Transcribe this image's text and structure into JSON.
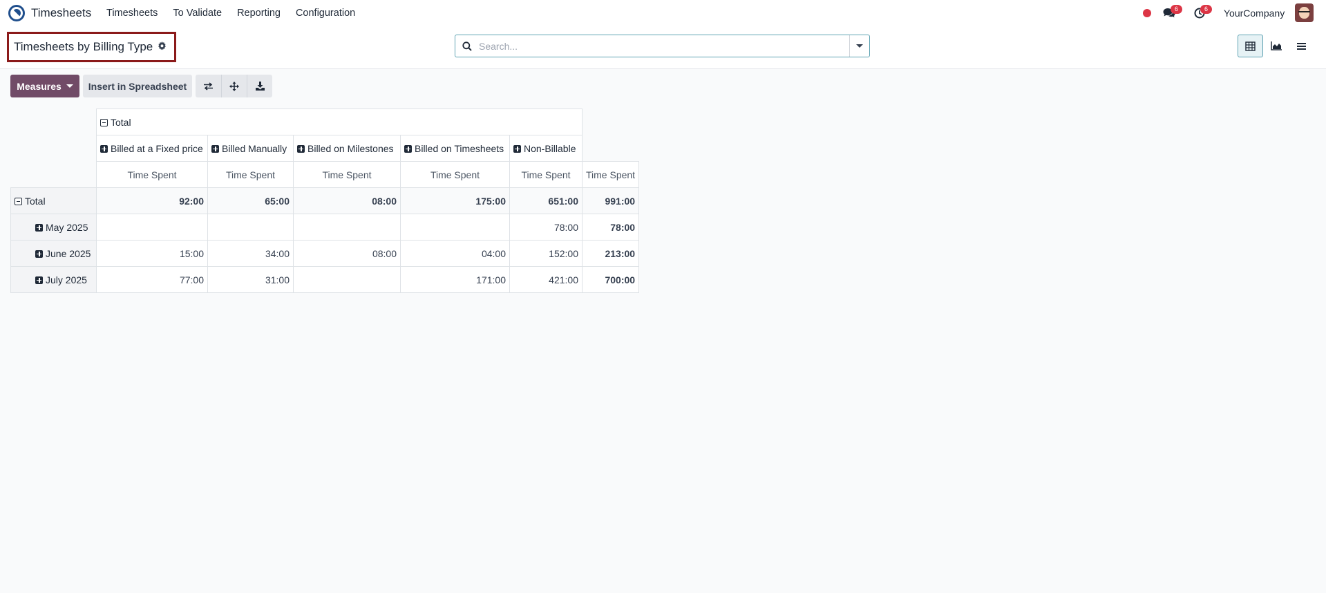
{
  "app": {
    "name": "Timesheets"
  },
  "nav": {
    "items": [
      "Timesheets",
      "To Validate",
      "Reporting",
      "Configuration"
    ]
  },
  "systray": {
    "messages_count": "6",
    "activities_count": "6",
    "company": "YourCompany"
  },
  "page": {
    "title": "Timesheets by Billing Type"
  },
  "search": {
    "placeholder": "Search...",
    "value": ""
  },
  "toolbar": {
    "measures_label": "Measures",
    "insert_label": "Insert in Spreadsheet"
  },
  "pivot": {
    "col_total_label": "Total",
    "columns": [
      "Billed at a Fixed price",
      "Billed Manually",
      "Billed on Milestones",
      "Billed on Timesheets",
      "Non-Billable"
    ],
    "measure": "Time Spent",
    "total_row": {
      "label": "Total",
      "values": [
        "92:00",
        "65:00",
        "08:00",
        "175:00",
        "651:00"
      ],
      "total": "991:00"
    },
    "rows": [
      {
        "label": "May 2025",
        "values": [
          "",
          "",
          "",
          "",
          "78:00"
        ],
        "total": "78:00"
      },
      {
        "label": "June 2025",
        "values": [
          "15:00",
          "34:00",
          "08:00",
          "04:00",
          "152:00"
        ],
        "total": "213:00"
      },
      {
        "label": "July 2025",
        "values": [
          "77:00",
          "31:00",
          "",
          "171:00",
          "421:00"
        ],
        "total": "700:00"
      }
    ]
  }
}
